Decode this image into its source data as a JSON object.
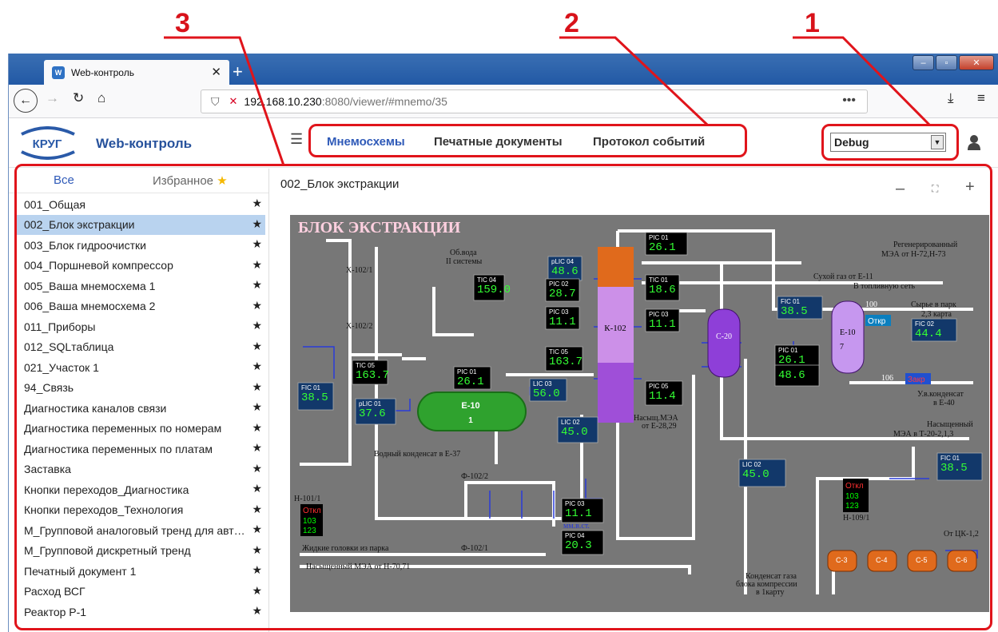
{
  "annotations": {
    "n1": "1",
    "n2": "2",
    "n3": "3"
  },
  "browser": {
    "tab_title": "Web-контроль",
    "favicon_text": "W",
    "new_tab": "+",
    "tab_close": "✕",
    "url_host": "192.168.10.230",
    "url_rest": ":8080/viewer/#mnemo/35",
    "window_controls": [
      "–",
      "▫",
      "✕"
    ]
  },
  "app": {
    "logo_text": "КРУГ",
    "title": "Web-контроль",
    "nav": [
      "Мнемосхемы",
      "Печатные документы",
      "Протокол событий"
    ],
    "user_select": "Debug"
  },
  "sidebar": {
    "tab_all": "Все",
    "tab_fav": "Избранное",
    "items": [
      "001_Общая",
      "002_Блок экстракции",
      "003_Блок гидроочистки",
      "004_Поршневой компрессор",
      "005_Ваша мнемосхема 1",
      "006_Ваша мнемосхема 2",
      "011_Приборы",
      "012_SQLтаблица",
      "021_Участок 1",
      "94_Связь",
      "Диагностика каналов связи",
      "Диагностика переменных по номерам",
      "Диагностика переменных по платам",
      "Заставка",
      "Кнопки переходов_Диагностика",
      "Кнопки переходов_Технология",
      "М_Групповой аналоговый тренд для автоматизации",
      "М_Групповой дискретный тренд",
      "Печатный документ 1",
      "Расход ВСГ",
      "Реактор Р-1"
    ],
    "active_index": 1
  },
  "main": {
    "title": "002_Блок экстракции",
    "zoom_out": "–",
    "zoom_fit": "⛶",
    "zoom_in": "+"
  },
  "scheme": {
    "title": "БЛОК ЭКСТРАКЦИИ",
    "labels": {
      "x1021": "X-102/1",
      "x1022": "X-102/2",
      "obvoda1": "Об.вода",
      "obvoda2": "II системы",
      "vodniy": "Водный конденсат в Е-37",
      "f1022": "Ф-102/2",
      "f1021": "Ф-102/1",
      "h1011": "Н-101/1",
      "zhidkie": "Жидкие головки из парка",
      "nasMEA": "Насыщенный МЭА от Н-70,71",
      "regen1": "Регенерированный",
      "regen2": "МЭА от Н-72,Н-73",
      "suhoy": "Сухой газ от Е-11",
      "toplivo": "В топливную сеть",
      "syrye1": "Сырье в парк",
      "syrye2": "2,3 карта",
      "uvkond1": "У.в.конденсат",
      "uvkond2": "в Е-40",
      "nasM1": "Насыщенный",
      "nasM2": "МЭА в Т-20-2,1,3",
      "h1091": "Н-109/1",
      "otck": "От ЦК-1,2",
      "kond1": "Конденсат газа",
      "kond2": "блока компрессии",
      "kond3": "в 1карту",
      "nasE1": "Насыщ.МЭА",
      "nasE2": "от Е-28,29",
      "mmst": "мм.в.ст.",
      "e10": "Е-10",
      "e10b": "1",
      "k102": "К-102",
      "e10r": "Е-10",
      "e10r2": "7",
      "c20": "С-20",
      "c3": "С-3",
      "c4": "С-4",
      "c5": "С-5",
      "c6": "С-6",
      "v100": "100",
      "v106": "106"
    },
    "instruments": [
      {
        "tag": "TIC 04",
        "val": "159.0"
      },
      {
        "tag": "pLIC 04",
        "val": "48.6"
      },
      {
        "tag": "PIC 02",
        "val": "28.7"
      },
      {
        "tag": "PIC 03",
        "val": "11.1"
      },
      {
        "tag": "TIC 05",
        "val": "163.7"
      },
      {
        "tag": "PIC 01",
        "val": "26.1"
      },
      {
        "tag": "TIC 01",
        "val": "18.6"
      },
      {
        "tag": "PIC 03",
        "val": "11.1"
      },
      {
        "tag": "TIC 05",
        "val": "163.7"
      },
      {
        "tag": "FIC 01",
        "val": "38.5"
      },
      {
        "tag": "pLIC 01",
        "val": "37.6"
      },
      {
        "tag": "PIC 01",
        "val": "26.1"
      },
      {
        "tag": "LIC 03",
        "val": "56.0"
      },
      {
        "tag": "PIC 05",
        "val": "11.4"
      },
      {
        "tag": "LIC 02",
        "val": "45.0"
      },
      {
        "tag": "PIC 03",
        "val": "11.1"
      },
      {
        "tag": "PIC 04",
        "val": "20.3"
      },
      {
        "tag": "FIC 01",
        "val": "38.5"
      },
      {
        "tag": "PIC 01",
        "val": "26.1"
      },
      {
        "tag": "",
        "val": "48.6"
      },
      {
        "tag": "LIC 02",
        "val": "45.0"
      },
      {
        "tag": "FIC 02",
        "val": "44.4"
      },
      {
        "tag": "FIC 01",
        "val": "38.5"
      }
    ],
    "otkl": "Откл",
    "counter1": "103",
    "counter2": "123",
    "otkr": "Откр",
    "zakr": "Закр"
  }
}
